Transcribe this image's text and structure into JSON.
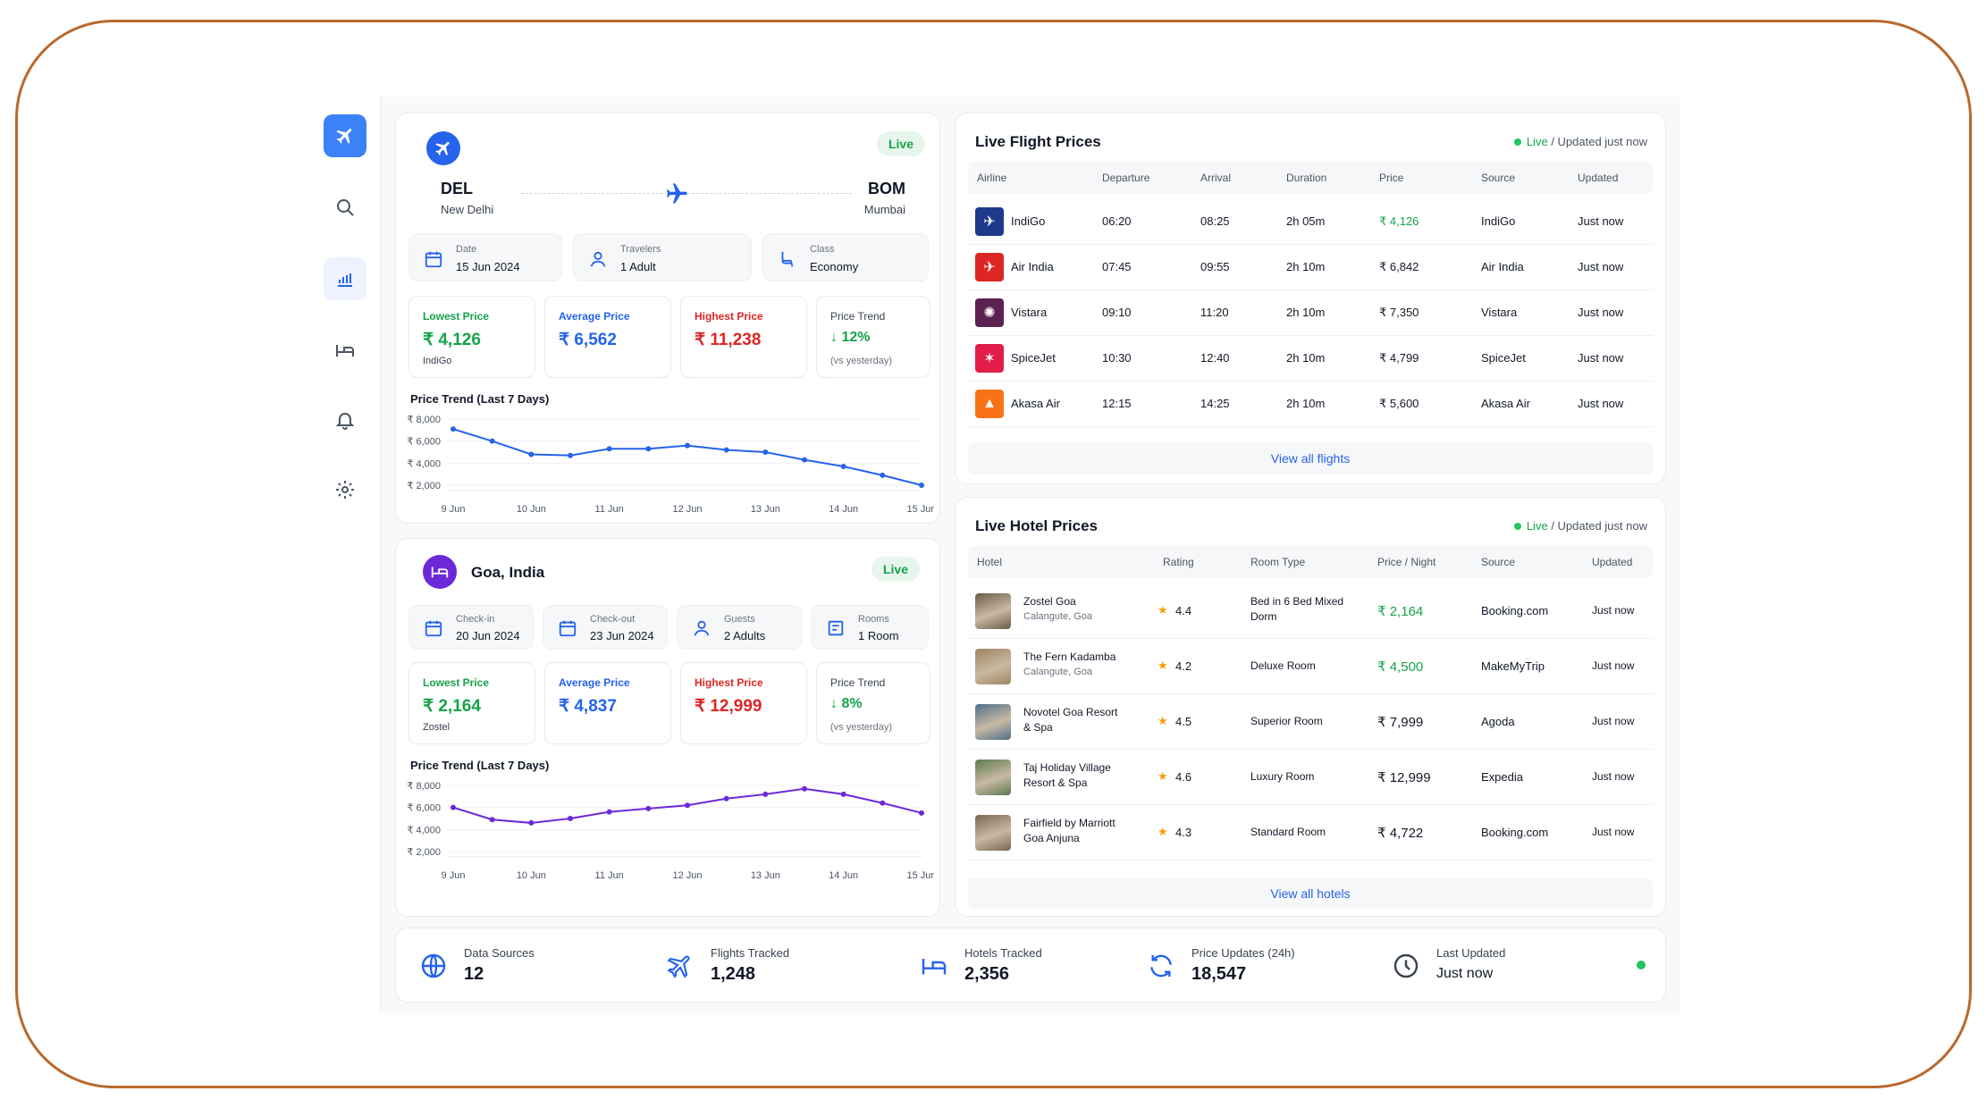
{
  "flight": {
    "badge": "Live",
    "from_code": "DEL",
    "from_city": "New Delhi",
    "to_code": "BOM",
    "to_city": "Mumbai",
    "date_label": "Date",
    "date_value": "15 Jun 2024",
    "travelers_label": "Travelers",
    "travelers_value": "1 Adult",
    "class_label": "Class",
    "class_value": "Economy",
    "stats": {
      "lowest_label": "Lowest Price",
      "lowest_value": "₹ 4,126",
      "lowest_sub": "IndiGo",
      "average_label": "Average Price",
      "average_value": "₹ 6,562",
      "highest_label": "Highest Price",
      "highest_value": "₹ 11,238",
      "trend_label": "Price Trend",
      "trend_value": "↓ 12%",
      "trend_sub": "(vs yesterday)"
    },
    "chart_title": "Price Trend (Last 7 Days)"
  },
  "hotel": {
    "badge": "Live",
    "location": "Goa, India",
    "checkin_label": "Check-in",
    "checkin_value": "20 Jun 2024",
    "checkout_label": "Check-out",
    "checkout_value": "23 Jun 2024",
    "guests_label": "Guests",
    "guests_value": "2 Adults",
    "rooms_label": "Rooms",
    "rooms_value": "1 Room",
    "stats": {
      "lowest_label": "Lowest Price",
      "lowest_value": "₹ 2,164",
      "lowest_sub": "Zostel",
      "average_label": "Average Price",
      "average_value": "₹ 4,837",
      "highest_label": "Highest Price",
      "highest_value": "₹ 12,999",
      "trend_label": "Price Trend",
      "trend_value": "↓ 8%",
      "trend_sub": "(vs yesterday)"
    },
    "chart_title": "Price Trend (Last 7 Days)"
  },
  "chart_data": [
    {
      "type": "line",
      "title": "Price Trend (Last 7 Days)",
      "x": [
        "9 Jun",
        "10 Jun",
        "11 Jun",
        "12 Jun",
        "13 Jun",
        "14 Jun",
        "15 Jun"
      ],
      "x_points": [
        0,
        0.5,
        1,
        1.5,
        2,
        2.5,
        3,
        3.5,
        4,
        4.5,
        5,
        5.5,
        6
      ],
      "values": [
        7100,
        6000,
        4800,
        4700,
        5300,
        5300,
        5600,
        5200,
        5000,
        4300,
        3700,
        2900,
        2000
      ],
      "yticks": [
        "₹ 8,000",
        "₹ 6,000",
        "₹ 4,000",
        "₹ 2,000"
      ],
      "ylim": [
        2000,
        8000
      ],
      "color": "#2563eb"
    },
    {
      "type": "line",
      "title": "Price Trend (Last 7 Days)",
      "x": [
        "9 Jun",
        "10 Jun",
        "11 Jun",
        "12 Jun",
        "13 Jun",
        "14 Jun",
        "15 Jun"
      ],
      "x_points": [
        0,
        0.5,
        1,
        1.5,
        2,
        2.5,
        3,
        3.5,
        4,
        4.5,
        5,
        5.5,
        6
      ],
      "values": [
        6000,
        4900,
        4600,
        5000,
        5600,
        5900,
        6200,
        6800,
        7200,
        7700,
        7200,
        6400,
        5500
      ],
      "yticks": [
        "₹ 8,000",
        "₹ 6,000",
        "₹ 4,000",
        "₹ 2,000"
      ],
      "ylim": [
        2000,
        8000
      ],
      "color": "#6d28d9"
    }
  ],
  "flights": {
    "title": "Live Flight Prices",
    "live": "Live",
    "updated": "/ Updated just now",
    "headers": [
      "Airline",
      "Departure",
      "Arrival",
      "Duration",
      "Price",
      "Source",
      "Updated"
    ],
    "rows": [
      {
        "airline": "IndiGo",
        "dep": "06:20",
        "arr": "08:25",
        "dur": "2h 05m",
        "price": "₹ 4,126",
        "source": "IndiGo",
        "updated": "Just now",
        "color": "#1e3a8a",
        "icon": "✈",
        "highlight": true
      },
      {
        "airline": "Air India",
        "dep": "07:45",
        "arr": "09:55",
        "dur": "2h 10m",
        "price": "₹ 6,842",
        "source": "Air India",
        "updated": "Just now",
        "color": "#dc2626",
        "icon": "✈"
      },
      {
        "airline": "Vistara",
        "dep": "09:10",
        "arr": "11:20",
        "dur": "2h 10m",
        "price": "₹ 7,350",
        "source": "Vistara",
        "updated": "Just now",
        "color": "#5b2150",
        "icon": "✺"
      },
      {
        "airline": "SpiceJet",
        "dep": "10:30",
        "arr": "12:40",
        "dur": "2h 10m",
        "price": "₹ 4,799",
        "source": "SpiceJet",
        "updated": "Just now",
        "color": "#e11d48",
        "icon": "✶"
      },
      {
        "airline": "Akasa Air",
        "dep": "12:15",
        "arr": "14:25",
        "dur": "2h 10m",
        "price": "₹ 5,600",
        "source": "Akasa Air",
        "updated": "Just now",
        "color": "#f97316",
        "icon": "▲"
      }
    ],
    "view_all": "View all flights"
  },
  "hotels": {
    "title": "Live Hotel Prices",
    "live": "Live",
    "updated": "/ Updated just now",
    "headers": [
      "Hotel",
      "Rating",
      "Room Type",
      "Price / Night",
      "Source",
      "Updated"
    ],
    "rows": [
      {
        "name1": "Zostel Goa",
        "name2": "",
        "loc": "Calangute, Goa",
        "rating": "4.4",
        "room1": "Bed in 6 Bed Mixed",
        "room2": "Dorm",
        "price": "₹ 2,164",
        "source": "Booking.com",
        "updated": "Just now",
        "highlight": true
      },
      {
        "name1": "The Fern Kadamba",
        "name2": "",
        "loc": "Calangute, Goa",
        "rating": "4.2",
        "room1": "Deluxe Room",
        "room2": "",
        "price": "₹ 4,500",
        "source": "MakeMyTrip",
        "updated": "Just now",
        "highlight": true
      },
      {
        "name1": "Novotel Goa Resort",
        "name2": "& Spa",
        "loc": "",
        "rating": "4.5",
        "room1": "Superior Room",
        "room2": "",
        "price": "₹ 7,999",
        "source": "Agoda",
        "updated": "Just now"
      },
      {
        "name1": "Taj Holiday Village",
        "name2": "Resort & Spa",
        "loc": "",
        "rating": "4.6",
        "room1": "Luxury Room",
        "room2": "",
        "price": "₹ 12,999",
        "source": "Expedia",
        "updated": "Just now"
      },
      {
        "name1": "Fairfield by Marriott",
        "name2": "Goa Anjuna",
        "loc": "",
        "rating": "4.3",
        "room1": "Standard Room",
        "room2": "",
        "price": "₹ 4,722",
        "source": "Booking.com",
        "updated": "Just now"
      }
    ],
    "view_all": "View all hotels"
  },
  "summary": {
    "data_sources_label": "Data Sources",
    "data_sources_value": "12",
    "flights_label": "Flights Tracked",
    "flights_value": "1,248",
    "hotels_label": "Hotels Tracked",
    "hotels_value": "2,356",
    "updates_label": "Price Updates (24h)",
    "updates_value": "18,547",
    "last_label": "Last Updated",
    "last_value": "Just now"
  },
  "colors": {
    "accent": "#2563eb",
    "green": "#16a34a",
    "red": "#dc2626",
    "purple": "#6d28d9"
  }
}
